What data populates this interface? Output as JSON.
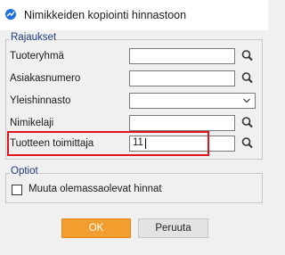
{
  "window": {
    "title": "Nimikkeiden kopiointi hinnastoon",
    "app_icon": "chart-line-icon"
  },
  "filters": {
    "legend": "Rajaukset",
    "rows": [
      {
        "label": "Tuoteryhmä",
        "value": "",
        "kind": "text"
      },
      {
        "label": "Asiakasnumero",
        "value": "",
        "kind": "text"
      },
      {
        "label": "Yleishinnasto",
        "value": "",
        "kind": "select"
      },
      {
        "label": "Nimikelaji",
        "value": "",
        "kind": "text"
      },
      {
        "label": "Tuotteen toimittaja",
        "value": "11",
        "kind": "text",
        "highlighted": true
      }
    ]
  },
  "options": {
    "legend": "Optiot",
    "modify_existing_prices": {
      "label": "Muuta olemassaolevat hinnat",
      "checked": false
    }
  },
  "buttons": {
    "ok": "OK",
    "cancel": "Peruuta"
  },
  "colors": {
    "accent_orange": "#f39d2e",
    "highlight_red": "#e0141e",
    "legend_blue": "#1f3a78"
  }
}
